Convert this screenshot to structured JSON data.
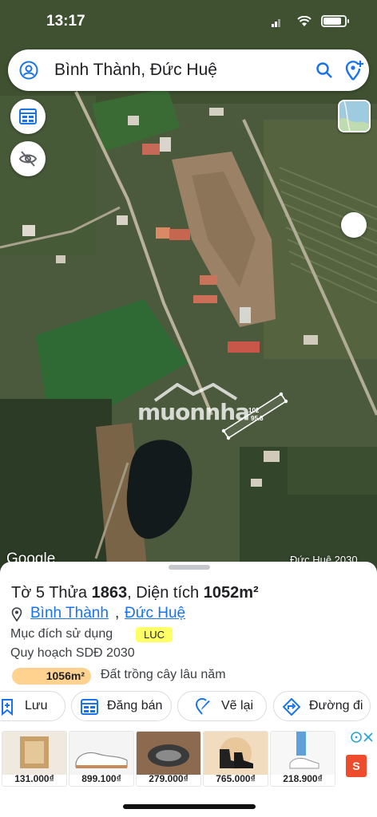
{
  "status_bar": {
    "time": "13:17",
    "battery_level": 0.85
  },
  "search": {
    "query": "Bình Thành, Đức Huệ"
  },
  "map": {
    "watermark": "muonnha",
    "plot_dims": {
      "top": "102",
      "side": "95.8"
    },
    "attribution": "Google",
    "plan_overlay": "Đức Huệ 2030"
  },
  "parcel": {
    "title_prefix": "Tờ 5 Thửa ",
    "parcel_no": "1863",
    "title_mid": ", Diện tích ",
    "area": "1052m²",
    "commune": "Bình Thành",
    "separator": ", ",
    "district": "Đức Huệ",
    "purpose_label": "Mục đích sử dụng",
    "purpose_code": "LUC",
    "plan_label": "Quy hoạch SDĐ 2030",
    "plan_area": "1056m²",
    "plan_desc": "Đất trồng cây lâu năm"
  },
  "actions": {
    "save": "Lưu",
    "post": "Đăng bán",
    "draw": "Vẽ lại",
    "directions": "Đường đi"
  },
  "ads": [
    {
      "price": "131.000₫"
    },
    {
      "price": "899.100₫"
    },
    {
      "price": "279.000₫"
    },
    {
      "price": "765.000₫"
    },
    {
      "price": "218.900₫"
    }
  ],
  "colors": {
    "accent": "#1a73e8",
    "badge": "#ffff66",
    "plan_pill": "#ffd28f",
    "shopee": "#ee4d2d"
  }
}
